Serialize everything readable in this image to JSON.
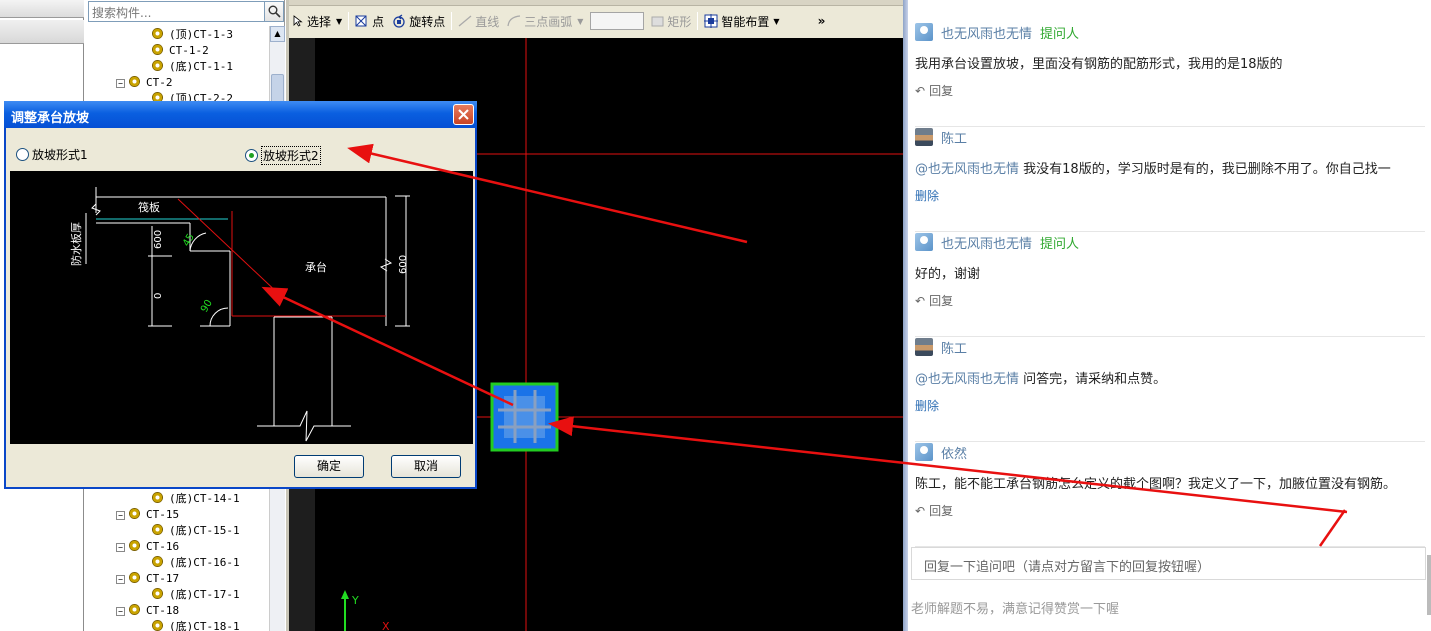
{
  "tree": {
    "search_placeholder": "搜索构件...",
    "top_items": [
      {
        "label": "(顶)CT-1-3",
        "kind": "leaf"
      },
      {
        "label": "CT-1-2",
        "kind": "leaf"
      },
      {
        "label": "(底)CT-1-1",
        "kind": "leaf"
      },
      {
        "label": "CT-2",
        "kind": "group"
      },
      {
        "label": "(顶)CT-2-2",
        "kind": "leaf"
      }
    ],
    "bottom_items": [
      {
        "label": "(底)CT-14-1",
        "kind": "leaf"
      },
      {
        "label": "CT-15",
        "kind": "group"
      },
      {
        "label": "(底)CT-15-1",
        "kind": "leaf"
      },
      {
        "label": "CT-16",
        "kind": "group"
      },
      {
        "label": "(底)CT-16-1",
        "kind": "leaf"
      },
      {
        "label": "CT-17",
        "kind": "group"
      },
      {
        "label": "(底)CT-17-1",
        "kind": "leaf"
      },
      {
        "label": "CT-18",
        "kind": "group"
      },
      {
        "label": "(底)CT-18-1",
        "kind": "leaf"
      }
    ]
  },
  "toolbar": {
    "select": "选择",
    "point": "点",
    "rotate_point": "旋转点",
    "line": "直线",
    "arc": "三点画弧",
    "rect": "矩形",
    "smart_layout": "智能布置",
    "overflow": "»"
  },
  "canvas": {
    "axis_y": "Y",
    "axis_x": "X",
    "colors": {
      "crosshair": "#ff0000",
      "element_fill": "#1a73e8",
      "element_border": "#22cc22"
    }
  },
  "dialog": {
    "title": "调整承台放坡",
    "option1": "放坡形式1",
    "option2": "放坡形式2",
    "selected": "option2",
    "ok": "确定",
    "cancel": "取消",
    "drawing": {
      "label_raft": "筏板",
      "label_waterproof": "防水板厚",
      "label_cap": "承台",
      "dim_left_top": "600",
      "dim_left_bottom": "0",
      "dim_right": "600",
      "angle_top": "45",
      "angle_bottom": "90"
    }
  },
  "comments": [
    {
      "avatar": "user-avatar",
      "author": "也无风雨也无情",
      "tag": "提问人",
      "mention": "",
      "text": "我用承台设置放坡，里面没有钢筋的配筋形式，我用的是18版的",
      "action": "回复"
    },
    {
      "avatar": "teacher-avatar",
      "author": "陈工",
      "tag": "",
      "mention": "@也无风雨也无情",
      "text": "我没有18版的，学习版时是有的，我已删除不用了。你自己找一",
      "action": "删除"
    },
    {
      "avatar": "user-avatar",
      "author": "也无风雨也无情",
      "tag": "提问人",
      "mention": "",
      "text": "好的，谢谢",
      "action": "回复"
    },
    {
      "avatar": "teacher-avatar",
      "author": "陈工",
      "tag": "",
      "mention": "@也无风雨也无情",
      "text": "问答完，请采纳和点赞。",
      "action": "删除"
    },
    {
      "avatar": "user-avatar",
      "author": "依然",
      "tag": "",
      "mention": "",
      "text": "陈工，能不能工承台钢筋怎么定义的截个图啊？我定义了一下，加腋位置没有钢筋。",
      "action": "回复"
    }
  ],
  "reply_placeholder": "回复一下追问吧（请点对方留言下的回复按钮喔）",
  "footer_note": "老师解题不易，满意记得赞赏一下喔"
}
